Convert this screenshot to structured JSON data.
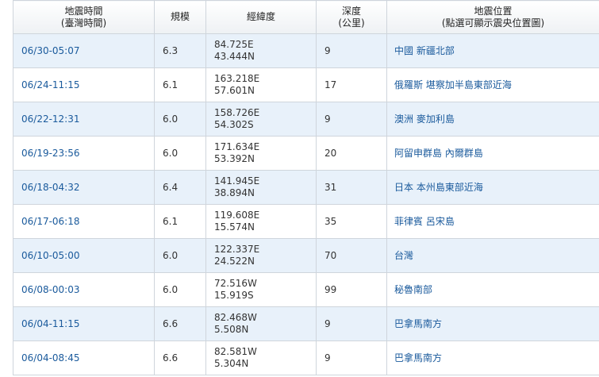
{
  "table": {
    "headers": {
      "time": [
        "地震時間",
        "(臺灣時間)"
      ],
      "magnitude": [
        "規模"
      ],
      "coords": [
        "經緯度"
      ],
      "depth": [
        "深度",
        "(公里)"
      ],
      "location": [
        "地震位置",
        "(點選可顯示震央位置圖)"
      ]
    },
    "rows": [
      {
        "time": "06/30-05:07",
        "magnitude": "6.3",
        "lon": "84.725E",
        "lat": "43.444N",
        "depth": "9",
        "location": "中國 新疆北部"
      },
      {
        "time": "06/24-11:15",
        "magnitude": "6.1",
        "lon": "163.218E",
        "lat": "57.601N",
        "depth": "17",
        "location": "俄羅斯 堪察加半島東部近海"
      },
      {
        "time": "06/22-12:31",
        "magnitude": "6.0",
        "lon": "158.726E",
        "lat": "54.302S",
        "depth": "9",
        "location": "澳洲 麥加利島"
      },
      {
        "time": "06/19-23:56",
        "magnitude": "6.0",
        "lon": "171.634E",
        "lat": "53.392N",
        "depth": "20",
        "location": "阿留申群島 內爾群島"
      },
      {
        "time": "06/18-04:32",
        "magnitude": "6.4",
        "lon": "141.945E",
        "lat": "38.894N",
        "depth": "31",
        "location": "日本 本州島東部近海"
      },
      {
        "time": "06/17-06:18",
        "magnitude": "6.1",
        "lon": "119.608E",
        "lat": "15.574N",
        "depth": "35",
        "location": "菲律賓 呂宋島"
      },
      {
        "time": "06/10-05:00",
        "magnitude": "6.0",
        "lon": "122.337E",
        "lat": "24.522N",
        "depth": "70",
        "location": "台灣"
      },
      {
        "time": "06/08-00:03",
        "magnitude": "6.0",
        "lon": "72.516W",
        "lat": "15.919S",
        "depth": "99",
        "location": "秘魯南部"
      },
      {
        "time": "06/04-11:15",
        "magnitude": "6.6",
        "lon": "82.468W",
        "lat": "5.508N",
        "depth": "9",
        "location": "巴拿馬南方"
      },
      {
        "time": "06/04-08:45",
        "magnitude": "6.6",
        "lon": "82.581W",
        "lat": "5.304N",
        "depth": "9",
        "location": "巴拿馬南方"
      }
    ]
  },
  "colors": {
    "link": "#1a5a9c",
    "row_alt": "#e8f1fa",
    "border": "#cfd5dc"
  }
}
